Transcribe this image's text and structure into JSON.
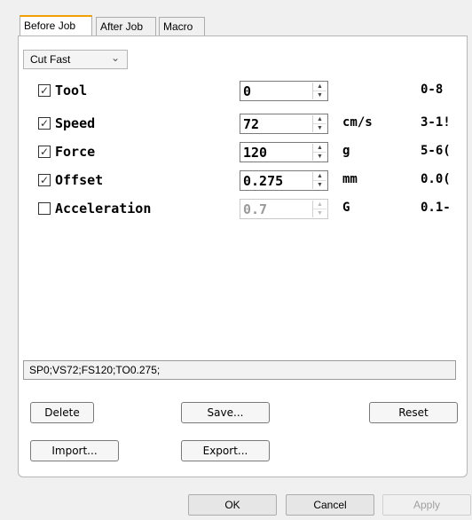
{
  "tabs": [
    "Before Job",
    "After Job",
    "Macro"
  ],
  "preset": {
    "selected": "Cut Fast"
  },
  "params": [
    {
      "label": "Tool",
      "checked": true,
      "value": "0",
      "unit": "",
      "range": "0-8",
      "enabled": true
    },
    {
      "label": "Speed",
      "checked": true,
      "value": "72",
      "unit": "cm/s",
      "range": "3-1!",
      "enabled": true
    },
    {
      "label": "Force",
      "checked": true,
      "value": "120",
      "unit": "g",
      "range": "5-6(",
      "enabled": true
    },
    {
      "label": "Offset",
      "checked": true,
      "value": "0.275",
      "unit": "mm",
      "range": "0.0(",
      "enabled": true
    },
    {
      "label": "Acceleration",
      "checked": false,
      "value": "0.7",
      "unit": "G",
      "range": "0.1-",
      "enabled": false
    }
  ],
  "command": "SP0;VS72;FS120;TO0.275;",
  "buttons": {
    "delete": "Delete",
    "save": "Save...",
    "reset": "Reset",
    "import": "Import...",
    "export": "Export..."
  },
  "dialog": {
    "ok": "OK",
    "cancel": "Cancel",
    "apply": "Apply"
  },
  "colors": {
    "active_tab_accent": "#f0a000",
    "disabled_text": "#9a9a9a"
  }
}
